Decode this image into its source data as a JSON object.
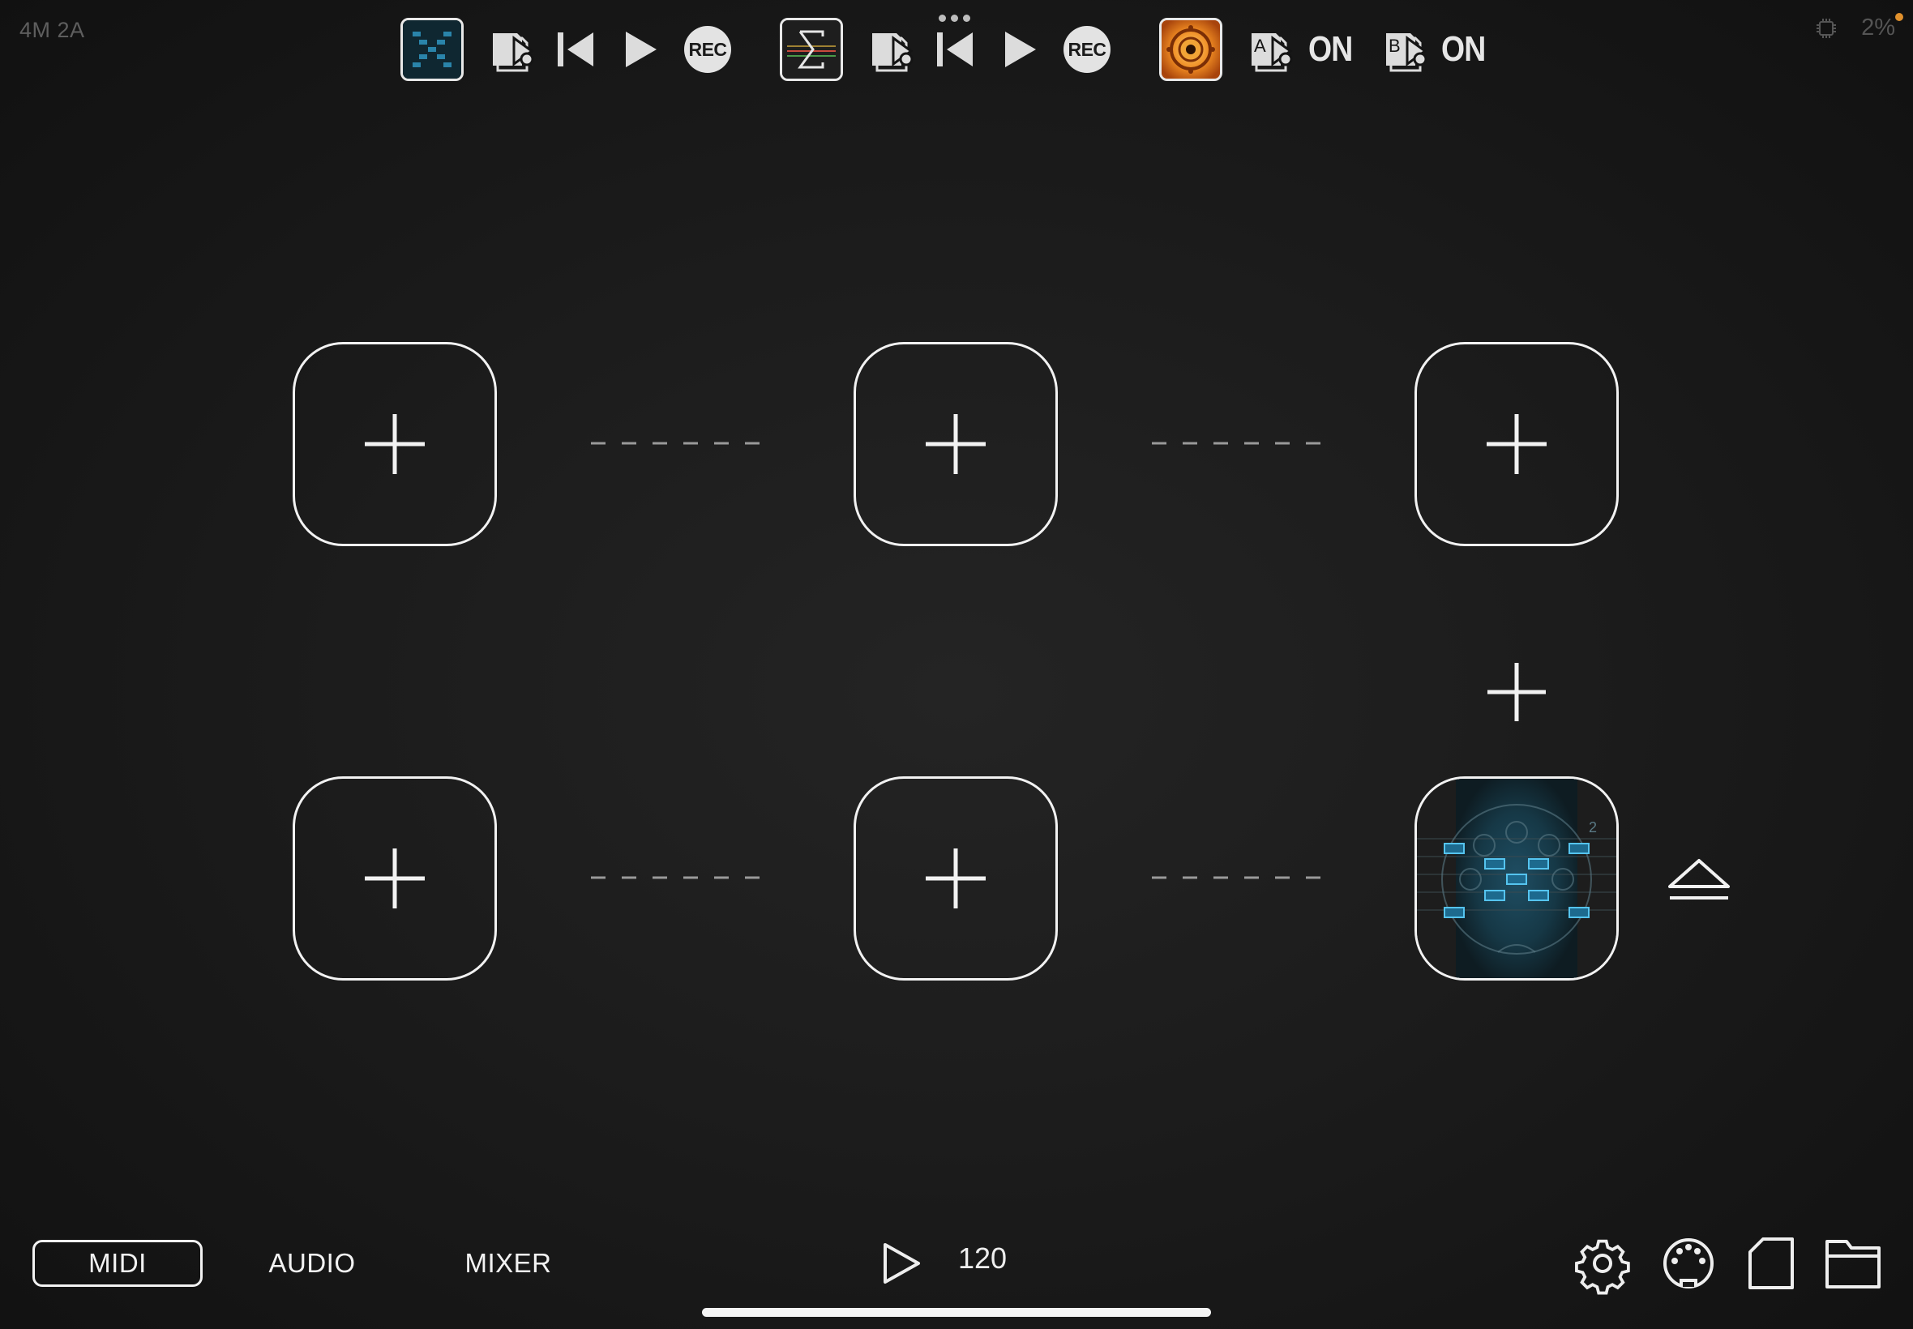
{
  "status": {
    "ports_label": "4M 2A",
    "cpu_percent": "2%",
    "cpu_icon": "chip-icon",
    "notification_color": "#e0902c"
  },
  "toolbar": {
    "slot1": {
      "thumb_icon": "midi-grid-plugin-thumb",
      "clip_icon": "clip-icon",
      "rewind_icon": "rewind-icon",
      "play_icon": "play-icon",
      "rec_label": "REC"
    },
    "slot2": {
      "thumb_icon": "sigma-plugin-thumb",
      "clip_icon": "clip-icon",
      "rewind_icon": "rewind-icon",
      "play_icon": "play-icon",
      "rec_label": "REC",
      "more_icon": "more-dots-icon"
    },
    "slot3": {
      "thumb_icon": "orange-dial-plugin-thumb",
      "a_label": "A",
      "a_state": "ON",
      "b_label": "B",
      "b_state": "ON"
    }
  },
  "grid": {
    "slots": [
      {
        "row": 1,
        "col": 1,
        "state": "empty",
        "icon": "plus-icon"
      },
      {
        "row": 1,
        "col": 2,
        "state": "empty",
        "icon": "plus-icon"
      },
      {
        "row": 1,
        "col": 3,
        "state": "empty",
        "icon": "plus-icon"
      },
      {
        "row": 2,
        "col": 1,
        "state": "empty",
        "icon": "plus-icon"
      },
      {
        "row": 2,
        "col": 2,
        "state": "empty",
        "icon": "plus-icon"
      },
      {
        "row": 2,
        "col": 3,
        "state": "loaded",
        "icon": "midi-plugin-thumb"
      }
    ],
    "add_row_icon": "plus-icon",
    "eject_icon": "eject-icon",
    "accent_color": "#3fa6d8"
  },
  "bottom": {
    "tabs": [
      {
        "label": "MIDI",
        "active": true
      },
      {
        "label": "AUDIO",
        "active": false
      },
      {
        "label": "MIXER",
        "active": false
      }
    ],
    "transport_play_icon": "play-outline-icon",
    "tempo": "120",
    "icons": [
      "gear-icon",
      "midi-port-icon",
      "file-icon",
      "folder-icon"
    ]
  }
}
